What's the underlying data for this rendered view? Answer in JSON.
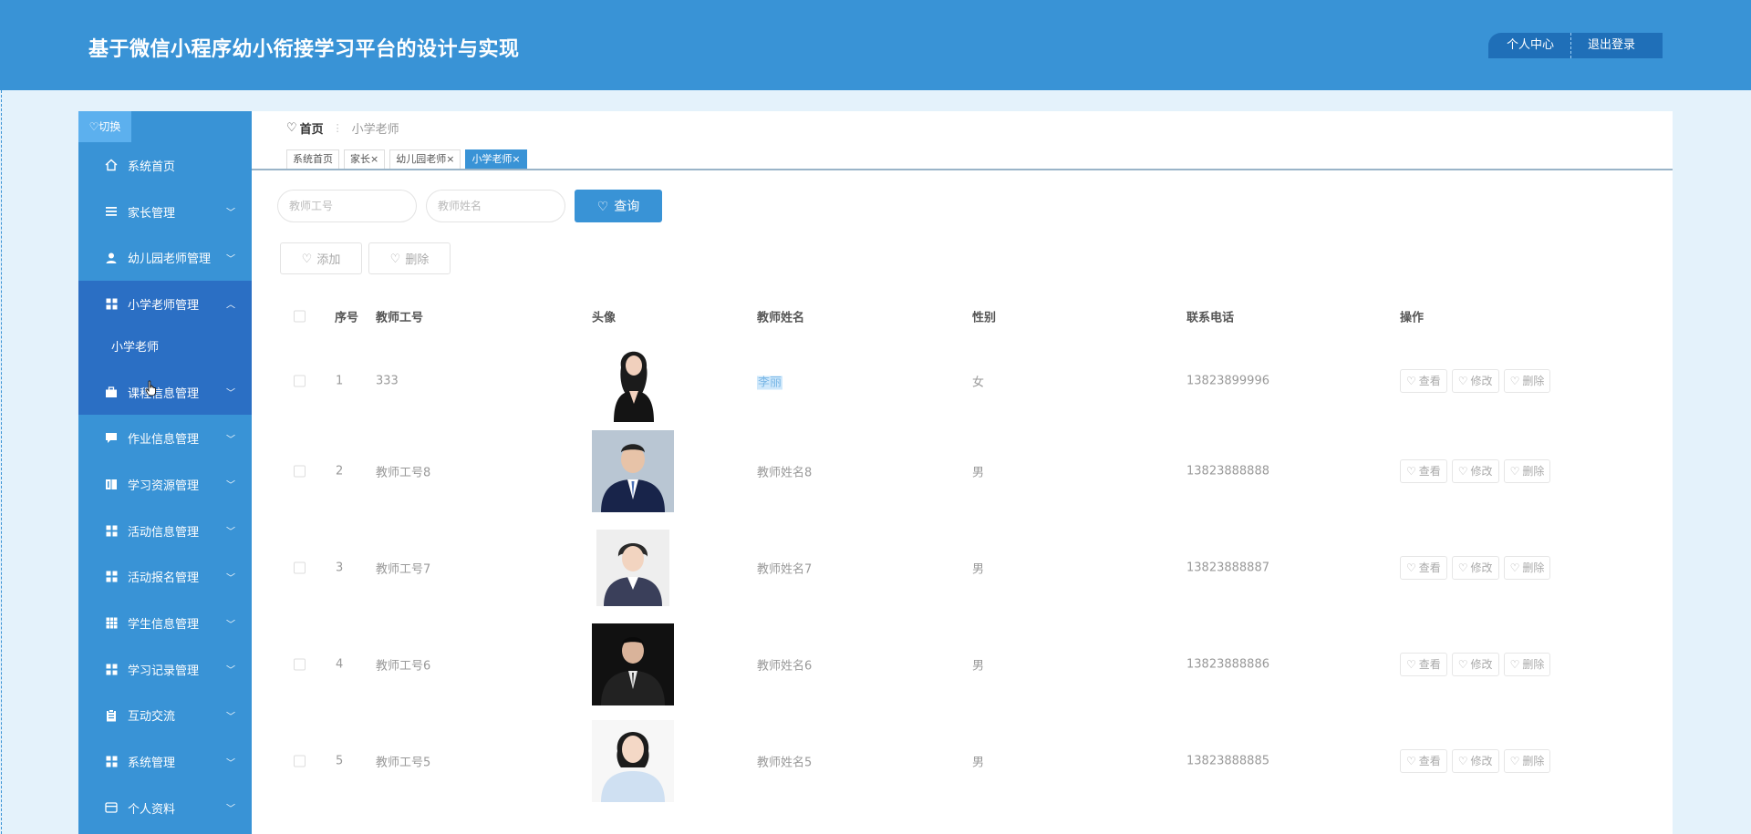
{
  "header": {
    "title": "基于微信小程序幼小衔接学习平台的设计与实现",
    "personal_center": "个人中心",
    "logout": "退出登录"
  },
  "sidebar": {
    "switch_label": "♡切换",
    "items": [
      {
        "label": "系统首页",
        "icon": "home-icon"
      },
      {
        "label": "家长管理",
        "icon": "list-icon"
      },
      {
        "label": "幼儿园老师管理",
        "icon": "user-icon"
      },
      {
        "label": "小学老师管理",
        "icon": "grid-icon"
      },
      {
        "label": "课程信息管理",
        "icon": "briefcase-icon"
      },
      {
        "label": "作业信息管理",
        "icon": "chat-icon"
      },
      {
        "label": "学习资源管理",
        "icon": "book-icon"
      },
      {
        "label": "活动信息管理",
        "icon": "grid-icon"
      },
      {
        "label": "活动报名管理",
        "icon": "grid-icon"
      },
      {
        "label": "学生信息管理",
        "icon": "table-icon"
      },
      {
        "label": "学习记录管理",
        "icon": "grid-icon"
      },
      {
        "label": "互动交流",
        "icon": "clipboard-icon"
      },
      {
        "label": "系统管理",
        "icon": "grid-icon"
      },
      {
        "label": "个人资料",
        "icon": "card-icon"
      }
    ],
    "submenu_label": "小学老师"
  },
  "breadcrumb": {
    "home": "首页",
    "current": "小学老师"
  },
  "tabs": [
    {
      "label": "系统首页"
    },
    {
      "label": "家长×"
    },
    {
      "label": "幼儿园老师×"
    },
    {
      "label": "小学老师×"
    }
  ],
  "search": {
    "teacher_no_placeholder": "教师工号",
    "teacher_name_placeholder": "教师姓名",
    "query_label": "查询"
  },
  "toolbar": {
    "add_label": "添加",
    "delete_label": "删除"
  },
  "table": {
    "headers": {
      "index": "序号",
      "teacher_no": "教师工号",
      "avatar": "头像",
      "teacher_name": "教师姓名",
      "gender": "性别",
      "phone": "联系电话",
      "ops": "操作"
    },
    "rows": [
      {
        "index": "1",
        "teacher_no": "333",
        "teacher_name": "李丽",
        "gender": "女",
        "phone": "13823899996"
      },
      {
        "index": "2",
        "teacher_no": "教师工号8",
        "teacher_name": "教师姓名8",
        "gender": "男",
        "phone": "13823888888"
      },
      {
        "index": "3",
        "teacher_no": "教师工号7",
        "teacher_name": "教师姓名7",
        "gender": "男",
        "phone": "13823888887"
      },
      {
        "index": "4",
        "teacher_no": "教师工号6",
        "teacher_name": "教师姓名6",
        "gender": "男",
        "phone": "13823888886"
      },
      {
        "index": "5",
        "teacher_no": "教师工号5",
        "teacher_name": "教师姓名5",
        "gender": "男",
        "phone": "13823888885"
      }
    ],
    "op_view": "查看",
    "op_edit": "修改",
    "op_delete": "删除"
  },
  "colors": {
    "primary": "#3993d6",
    "sidebar_active": "#2b6fc4",
    "page_bg": "#e4f2fb"
  }
}
